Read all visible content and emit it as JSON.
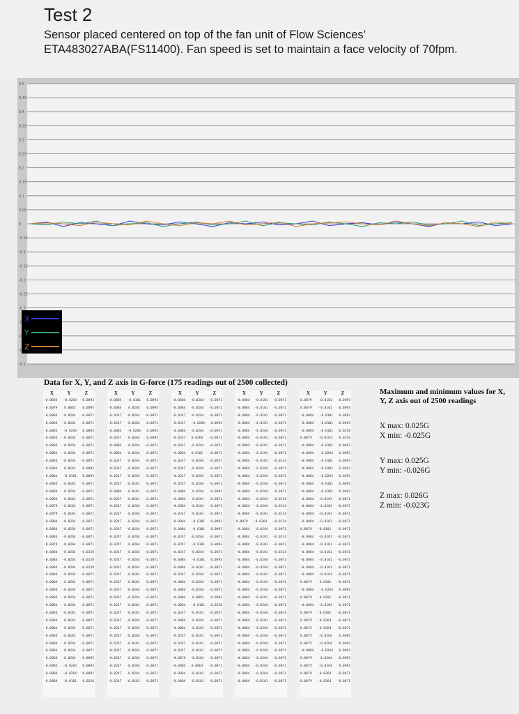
{
  "header": {
    "title": "Test 2",
    "subtitle": "Sensor placed centered on top of the fan unit of Flow Sciences’ ETA483027ABA(FS11400). Fan speed is set to maintain a face velocity of 70fpm."
  },
  "chart_data": {
    "type": "line",
    "title": "",
    "xlabel": "",
    "ylabel": "",
    "ylim": [
      -0.5,
      0.5
    ],
    "grid": true,
    "legend_position": "bottom-left",
    "series": [
      {
        "name": "X",
        "color": "#3a3ad0",
        "values": [
          0.0,
          0.007,
          -0.01,
          0.004,
          0.0,
          -0.007,
          0.01,
          0.0,
          -0.004,
          0.007,
          0.0,
          -0.01,
          0.004,
          0.0,
          0.007,
          -0.004,
          0.0,
          0.01,
          -0.007,
          0.0,
          0.004,
          -0.004,
          0.007,
          0.0,
          -0.01,
          0.004,
          0.0,
          0.007,
          -0.007,
          0.0
        ]
      },
      {
        "name": "Y",
        "color": "#2e9c7a",
        "values": [
          0.0,
          -0.004,
          0.007,
          0.0,
          0.01,
          -0.007,
          0.0,
          0.004,
          -0.01,
          0.0,
          0.007,
          -0.004,
          0.0,
          0.01,
          -0.007,
          0.004,
          0.0,
          -0.004,
          0.007,
          0.0,
          -0.01,
          0.004,
          0.0,
          0.007,
          -0.004,
          0.0,
          0.01,
          -0.007,
          0.0,
          0.004
        ]
      },
      {
        "name": "Z",
        "color": "#d08030",
        "values": [
          0.0,
          0.004,
          0.0,
          -0.007,
          0.007,
          0.0,
          -0.004,
          0.01,
          0.0,
          -0.007,
          0.004,
          0.0,
          0.01,
          -0.004,
          0.0,
          0.007,
          -0.01,
          0.0,
          0.004,
          0.007,
          0.0,
          -0.004,
          0.01,
          0.0,
          -0.007,
          0.004,
          0.0,
          -0.01,
          0.007,
          0.0
        ]
      }
    ]
  },
  "table": {
    "title": "Data for X, Y, and Z axis in G-force (175 readings out of 2500 collected)",
    "headers": [
      "X",
      "Y",
      "Z"
    ],
    "columns": [
      [
        [
          "-0.0084",
          "-0.0264",
          "0.0093"
        ],
        [
          "-0.0079",
          "0.0063",
          "0.0093"
        ],
        [
          "-0.0084",
          "-0.0264",
          "-0.0071"
        ],
        [
          "-0.0084",
          "-0.0264",
          "-0.0071"
        ],
        [
          "-0.0084",
          "-0.0264",
          "0.0093"
        ],
        [
          "-0.0084",
          "-0.0264",
          "-0.0071"
        ],
        [
          "-0.0084",
          "-0.0264",
          "-0.0071"
        ],
        [
          "-0.0084",
          "-0.0264",
          "-0.0071"
        ],
        [
          "-0.0084",
          "-0.0264",
          "-0.0071"
        ],
        [
          "-0.0084",
          "0.0101",
          "0.0093"
        ],
        [
          "-0.0084",
          "-0.0101",
          "0.0093"
        ],
        [
          "-0.0084",
          "-0.0101",
          "-0.0071"
        ],
        [
          "-0.0084",
          "-0.0264",
          "-0.0071"
        ],
        [
          "-0.0084",
          "-0.0101",
          "-0.0071"
        ],
        [
          "-0.0079",
          "-0.0101",
          "-0.0071"
        ],
        [
          "-0.0079",
          "-0.0101",
          "-0.0071"
        ],
        [
          "-0.0084",
          "-0.0264",
          "-0.0071"
        ],
        [
          "-0.0084",
          "-0.0264",
          "-0.0071"
        ],
        [
          "-0.0084",
          "-0.0264",
          "-0.0071"
        ],
        [
          "-0.0079",
          "-0.0264",
          "-0.0071"
        ],
        [
          "-0.0084",
          "-0.0264",
          "-0.0228"
        ],
        [
          "-0.0084",
          "-0.0264",
          "-0.0228"
        ],
        [
          "-0.0084",
          "-0.0264",
          "-0.0228"
        ],
        [
          "-0.0084",
          "-0.0264",
          "-0.0071"
        ],
        [
          "-0.0084",
          "-0.0264",
          "-0.0071"
        ],
        [
          "-0.0084",
          "-0.0264",
          "-0.0071"
        ],
        [
          "-0.0084",
          "-0.0264",
          "-0.0071"
        ],
        [
          "-0.0084",
          "-0.0264",
          "-0.0071"
        ],
        [
          "-0.0084",
          "-0.0101",
          "-0.0071"
        ],
        [
          "-0.0084",
          "-0.0101",
          "-0.0071"
        ],
        [
          "-0.0084",
          "-0.0264",
          "-0.0071"
        ],
        [
          "-0.0084",
          "-0.0101",
          "-0.0071"
        ],
        [
          "-0.0084",
          "-0.0264",
          "-0.0071"
        ],
        [
          "-0.0084",
          "-0.0264",
          "-0.0071"
        ],
        [
          "-0.0084",
          "-0.0264",
          "-0.0093"
        ],
        [
          "-0.0084",
          "-0.0264",
          "0.0093"
        ],
        [
          "-0.0084",
          "-0.0264",
          "0.0093"
        ],
        [
          "-0.0084",
          "-0.0101",
          "0.0256"
        ]
      ],
      [
        [
          "-0.0084",
          "-0.0101",
          "0.0093"
        ],
        [
          "-0.0084",
          "0.0264",
          "0.0093"
        ],
        [
          "-0.0247",
          "-0.0264",
          "-0.0071"
        ],
        [
          "-0.0247",
          "-0.0264",
          "-0.0071"
        ],
        [
          "-0.0084",
          "-0.0264",
          "0.0093"
        ],
        [
          "-0.0247",
          "0.0264",
          "0.0093"
        ],
        [
          "-0.0084",
          "-0.0264",
          "-0.0071"
        ],
        [
          "-0.0084",
          "-0.0264",
          "-0.0071"
        ],
        [
          "-0.0247",
          "-0.0264",
          "-0.0071"
        ],
        [
          "-0.0247",
          "-0.0264",
          "-0.0071"
        ],
        [
          "-0.0247",
          "-0.0264",
          "-0.0071"
        ],
        [
          "-0.0247",
          "-0.0101",
          "-0.0071"
        ],
        [
          "-0.0084",
          "-0.0101",
          "-0.0071"
        ],
        [
          "-0.0247",
          "-0.0101",
          "-0.0071"
        ],
        [
          "-0.0247",
          "-0.0264",
          "-0.0071"
        ],
        [
          "-0.0247",
          "-0.0264",
          "-0.0071"
        ],
        [
          "-0.0247",
          "-0.0264",
          "-0.0071"
        ],
        [
          "-0.0247",
          "-0.0264",
          "-0.0071"
        ],
        [
          "-0.0247",
          "-0.0264",
          "-0.0071"
        ],
        [
          "-0.0247",
          "-0.0264",
          "-0.0071"
        ],
        [
          "-0.0247",
          "-0.0264",
          "-0.0071"
        ],
        [
          "-0.0247",
          "-0.0264",
          "-0.0071"
        ],
        [
          "-0.0247",
          "-0.0264",
          "-0.0071"
        ],
        [
          "-0.0247",
          "-0.0101",
          "-0.0071"
        ],
        [
          "-0.0247",
          "-0.0101",
          "-0.0071"
        ],
        [
          "-0.0247",
          "-0.0264",
          "-0.0071"
        ],
        [
          "-0.0247",
          "-0.0264",
          "-0.0071"
        ],
        [
          "-0.0247",
          "-0.0101",
          "-0.0071"
        ],
        [
          "-0.0247",
          "-0.0101",
          "-0.0071"
        ],
        [
          "-0.0247",
          "-0.0264",
          "-0.0071"
        ],
        [
          "-0.0247",
          "-0.0264",
          "-0.0071"
        ],
        [
          "-0.0247",
          "-0.0264",
          "-0.0071"
        ],
        [
          "-0.0247",
          "-0.0101",
          "-0.0071"
        ],
        [
          "-0.0247",
          "-0.0264",
          "-0.0071"
        ],
        [
          "-0.0247",
          "-0.0264",
          "-0.0071"
        ],
        [
          "-0.0247",
          "-0.0264",
          "-0.0071"
        ],
        [
          "-0.0247",
          "-0.0264",
          "-0.0071"
        ],
        [
          "-0.0247",
          "-0.0101",
          "-0.0071"
        ]
      ],
      [
        [
          "-0.0084",
          "-0.0264",
          "-0.0071"
        ],
        [
          "-0.0084",
          "-0.0264",
          "-0.0071"
        ],
        [
          "-0.0247",
          "-0.0264",
          "-0.0071"
        ],
        [
          "-0.0247",
          "-0.0264",
          "0.0093"
        ],
        [
          "-0.0084",
          "-0.0264",
          "-0.0071"
        ],
        [
          "-0.0247",
          "0.0264",
          "-0.0071"
        ],
        [
          "-0.0247",
          "-0.0264",
          "-0.0071"
        ],
        [
          "-0.0084",
          "0.0101",
          "-0.0071"
        ],
        [
          "-0.0247",
          "-0.0264",
          "-0.0071"
        ],
        [
          "-0.0247",
          "-0.0264",
          "-0.0071"
        ],
        [
          "-0.0247",
          "-0.0264",
          "-0.0071"
        ],
        [
          "-0.0247",
          "-0.0264",
          "-0.0071"
        ],
        [
          "-0.0084",
          "0.0264",
          "0.0093"
        ],
        [
          "-0.0084",
          "-0.0101",
          "-0.0071"
        ],
        [
          "-0.0084",
          "-0.0101",
          "-0.0071"
        ],
        [
          "-0.0247",
          "-0.0101",
          "-0.0071"
        ],
        [
          "-0.0084",
          "-0.0101",
          "0.0093"
        ],
        [
          "-0.0084",
          "-0.0101",
          "0.0093"
        ],
        [
          "-0.0247",
          "-0.0264",
          "-0.0071"
        ],
        [
          "-0.0247",
          "-0.0101",
          "0.0093"
        ],
        [
          "-0.0247",
          "-0.0264",
          "-0.0071"
        ],
        [
          "-0.0084",
          "-0.0101",
          "0.0093"
        ],
        [
          "-0.0084",
          "-0.0101",
          "-0.0071"
        ],
        [
          "-0.0247",
          "-0.0264",
          "-0.0071"
        ],
        [
          "-0.0084",
          "-0.0264",
          "-0.0071"
        ],
        [
          "-0.0084",
          "-0.0264",
          "-0.0071"
        ],
        [
          "-0.0084",
          "0.0093",
          "0.0093"
        ],
        [
          "-0.0084",
          "-0.0101",
          "0.0256"
        ],
        [
          "-0.0247",
          "-0.0101",
          "-0.0071"
        ],
        [
          "-0.0084",
          "-0.0264",
          "-0.0071"
        ],
        [
          "-0.0084",
          "-0.0101",
          "-0.0071"
        ],
        [
          "-0.0247",
          "-0.0101",
          "-0.0071"
        ],
        [
          "-0.0247",
          "-0.0101",
          "-0.0071"
        ],
        [
          "-0.0247",
          "-0.0101",
          "-0.0071"
        ],
        [
          "-0.0079",
          "-0.0101",
          "-0.0071"
        ],
        [
          "-0.0084",
          "0.0063",
          "-0.0071"
        ],
        [
          "-0.0084",
          "-0.0101",
          "-0.0071"
        ],
        [
          "-0.0084",
          "-0.0101",
          "-0.0071"
        ]
      ],
      [
        [
          "-0.0084",
          "-0.0101",
          "-0.0071"
        ],
        [
          "-0.0084",
          "-0.0101",
          "-0.0071"
        ],
        [
          "-0.0084",
          "-0.0101",
          "-0.0071"
        ],
        [
          "-0.0084",
          "-0.0101",
          "-0.0071"
        ],
        [
          "-0.0084",
          "-0.0264",
          "-0.0071"
        ],
        [
          "-0.0084",
          "-0.0101",
          "-0.0071"
        ],
        [
          "-0.0084",
          "-0.0101",
          "-0.0071"
        ],
        [
          "-0.0084",
          "-0.0101",
          "-0.0071"
        ],
        [
          "-0.0084",
          "-0.0101",
          "-0.0214"
        ],
        [
          "-0.0084",
          "-0.0264",
          "-0.0071"
        ],
        [
          "-0.0084",
          "-0.0264",
          "-0.0071"
        ],
        [
          "-0.0084",
          "-0.0264",
          "-0.0071"
        ],
        [
          "-0.0084",
          "-0.0264",
          "-0.0071"
        ],
        [
          "-0.0084",
          "-0.0264",
          "-0.0214"
        ],
        [
          "-0.0084",
          "-0.0264",
          "-0.0214"
        ],
        [
          "-0.0084",
          "-0.0101",
          "-0.0214"
        ],
        [
          "0.0079",
          "-0.0264",
          "-0.0214"
        ],
        [
          "-0.0084",
          "-0.0264",
          "-0.0071"
        ],
        [
          "-0.0084",
          "-0.0101",
          "-0.0214"
        ],
        [
          "-0.0084",
          "-0.0101",
          "-0.0071"
        ],
        [
          "-0.0084",
          "-0.0101",
          "-0.0214"
        ],
        [
          "-0.0084",
          "-0.0264",
          "-0.0071"
        ],
        [
          "-0.0084",
          "-0.0264",
          "-0.0071"
        ],
        [
          "-0.0084",
          "-0.0101",
          "-0.0071"
        ],
        [
          "-0.0084",
          "-0.0101",
          "-0.0071"
        ],
        [
          "-0.0084",
          "-0.0264",
          "-0.0071"
        ],
        [
          "-0.0084",
          "-0.0101",
          "-0.0071"
        ],
        [
          "-0.0084",
          "-0.0264",
          "-0.0071"
        ],
        [
          "-0.0084",
          "-0.0264",
          "-0.0071"
        ],
        [
          "-0.0084",
          "-0.0101",
          "-0.0071"
        ],
        [
          "-0.0084",
          "-0.0264",
          "-0.0071"
        ],
        [
          "-0.0084",
          "-0.0264",
          "-0.0071"
        ],
        [
          "-0.0084",
          "-0.0264",
          "-0.0071"
        ],
        [
          "-0.0084",
          "-0.0264",
          "-0.0071"
        ],
        [
          "-0.0084",
          "-0.0264",
          "-0.0071"
        ],
        [
          "-0.0084",
          "-0.0264",
          "-0.0071"
        ],
        [
          "-0.0084",
          "-0.0264",
          "-0.0071"
        ],
        [
          "-0.0084",
          "-0.0101",
          "-0.0071"
        ]
      ],
      [
        [
          "0.0079",
          "-0.0101",
          "0.0093"
        ],
        [
          "0.0079",
          "-0.0101",
          "0.0093"
        ],
        [
          "-0.0084",
          "-0.0101",
          "0.0093"
        ],
        [
          "-0.0084",
          "-0.0101",
          "0.0093"
        ],
        [
          "-0.0084",
          "-0.0101",
          "0.0256"
        ],
        [
          "0.0079",
          "-0.0101",
          "0.0256"
        ],
        [
          "-0.0084",
          "-0.0101",
          "0.0093"
        ],
        [
          "-0.0084",
          "-0.0264",
          "0.0093"
        ],
        [
          "-0.0084",
          "-0.0101",
          "0.0093"
        ],
        [
          "-0.0084",
          "-0.0101",
          "0.0093"
        ],
        [
          "-0.0084",
          "-0.0264",
          "0.0093"
        ],
        [
          "-0.0084",
          "-0.0101",
          "0.0093"
        ],
        [
          "-0.0084",
          "-0.0101",
          "0.0093"
        ],
        [
          "-0.0084",
          "-0.0101",
          "-0.0071"
        ],
        [
          "-0.0084",
          "-0.0101",
          "-0.0071"
        ],
        [
          "-0.0084",
          "-0.0101",
          "-0.0071"
        ],
        [
          "-0.0084",
          "-0.0101",
          "-0.0071"
        ],
        [
          "0.0079",
          "-0.0101",
          "-0.0071"
        ],
        [
          "-0.0084",
          "-0.0101",
          "-0.0071"
        ],
        [
          "-0.0084",
          "-0.0101",
          "-0.0071"
        ],
        [
          "-0.0084",
          "-0.0101",
          "-0.0071"
        ],
        [
          "-0.0084",
          "-0.0101",
          "-0.0071"
        ],
        [
          "-0.0084",
          "-0.0101",
          "-0.0071"
        ],
        [
          "-0.0084",
          "-0.0101",
          "-0.0071"
        ],
        [
          "0.0079",
          "-0.0101",
          "-0.0071"
        ],
        [
          "-0.0084",
          "-0.0264",
          "0.0093"
        ],
        [
          "0.0079",
          "-0.0101",
          "-0.0071"
        ],
        [
          "-0.0084",
          "-0.0101",
          "-0.0071"
        ],
        [
          "0.0079",
          "-0.0101",
          "-0.0071"
        ],
        [
          "0.0079",
          "-0.0264",
          "-0.0071"
        ],
        [
          "0.0075",
          "-0.0264",
          "-0.0071"
        ],
        [
          "0.0075",
          "-0.0264",
          "0.0093"
        ],
        [
          "0.0075",
          "-0.0264",
          "0.0093"
        ],
        [
          "-0.0084",
          "-0.0264",
          "0.0093"
        ],
        [
          "0.0079",
          "-0.0264",
          "0.0093"
        ],
        [
          "0.0075",
          "-0.0264",
          "0.0093"
        ],
        [
          "0.0079",
          "-0.0264",
          "-0.0071"
        ],
        [
          "0.0079",
          "-0.0264",
          "-0.0071"
        ]
      ]
    ]
  },
  "summary": {
    "title": "Maximum and minimum values for X, Y, Z axis out of 2500 readings",
    "x_max": "X max: 0.025G",
    "x_min": "X min: -0.025G",
    "y_max": "Y max: 0.025G",
    "y_min": "Y min: -0.026G",
    "z_max": "Z max: 0.026G",
    "z_min": "Z min: -0.023G"
  },
  "y_tick_labels": [
    "0.5",
    "0.45",
    "0.4",
    "0.35",
    "0.3",
    "0.25",
    "0.2",
    "0.15",
    "0.1",
    "0.05",
    "0",
    "-0.05",
    "-0.1",
    "-0.15",
    "-0.2",
    "-0.25",
    "-0.3",
    "-0.35",
    "-0.4",
    "-0.45",
    "-0.5"
  ]
}
